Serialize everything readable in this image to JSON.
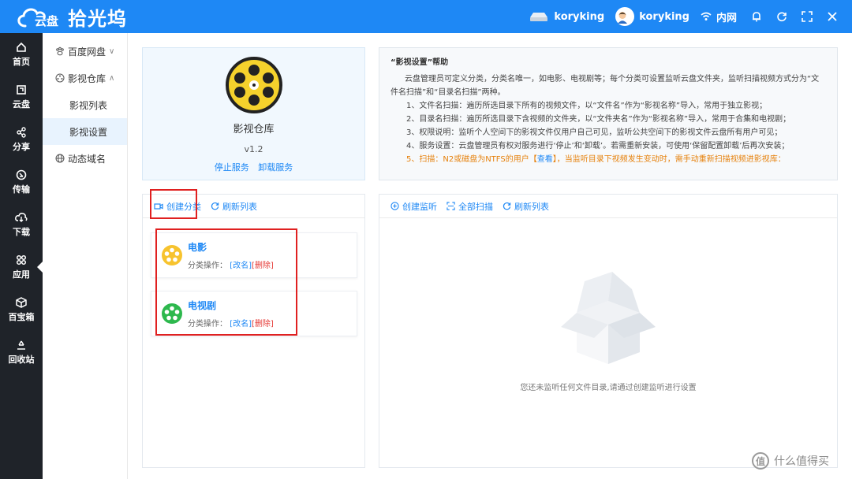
{
  "app": {
    "cloud_text": "云盘",
    "brand": "拾光坞"
  },
  "topbar": {
    "device_name": "koryking",
    "user_name": "koryking",
    "network": "内网"
  },
  "sidebar": {
    "items": [
      {
        "label": "首页",
        "icon": "home-icon"
      },
      {
        "label": "云盘",
        "icon": "disk-icon"
      },
      {
        "label": "分享",
        "icon": "share-icon"
      },
      {
        "label": "传输",
        "icon": "transfer-icon"
      },
      {
        "label": "下载",
        "icon": "download-icon"
      },
      {
        "label": "应用",
        "icon": "apps-icon"
      },
      {
        "label": "百宝箱",
        "icon": "toolbox-icon"
      },
      {
        "label": "回收站",
        "icon": "recycle-icon"
      }
    ]
  },
  "subnav": {
    "items": [
      {
        "label": "百度网盘"
      },
      {
        "label": "影视仓库"
      },
      {
        "label": "影视列表"
      },
      {
        "label": "影视设置"
      },
      {
        "label": "动态域名"
      }
    ]
  },
  "app_card": {
    "name": "影视仓库",
    "version": "v1.2",
    "stop": "停止服务",
    "uninstall": "卸载服务"
  },
  "help": {
    "title": "“影视设置”帮助",
    "intro": "云盘管理员可定义分类，分类名唯一，如电影、电视剧等；每个分类可设置监听云盘文件夹，监听扫描视频方式分为“文件名扫描”和“目录名扫描”两种。",
    "l1": "1、文件名扫描：遍历所选目录下所有的视频文件，以“文件名”作为“影视名称”导入，常用于独立影视；",
    "l2": "2、目录名扫描：遍历所选目录下含视频的文件夹，以“文件夹名”作为“影视名称”导入，常用于合集和电视剧；",
    "l3": "3、权限说明：监听个人空间下的影视文件仅用户自己可见，监听公共空间下的影视文件云盘所有用户可见；",
    "l4": "4、服务设置：云盘管理员有权对服务进行‘停止’和‘卸载’。若需重新安装，可使用‘保留配置卸载’后再次安装；",
    "l5a": "5、扫描：N2或磁盘为NTFS的用户【",
    "l5link": "查看",
    "l5b": "】，当监听目录下视频发生变动时，需手动重新扫描视频进影视库："
  },
  "left_panel": {
    "create_category": "创建分类",
    "refresh_list": "刷新列表",
    "ops_label": "分类操作：",
    "rename": "改名",
    "delete": "删除",
    "categories": [
      {
        "title": "电影"
      },
      {
        "title": "电视剧"
      }
    ]
  },
  "right_panel": {
    "create_monitor": "创建监听",
    "scan_all": "全部扫描",
    "refresh_list": "刷新列表",
    "empty_text": "您还未监听任何文件目录,请通过创建监听进行设置"
  },
  "watermark": {
    "glyph": "值",
    "text": "什么值得买"
  }
}
